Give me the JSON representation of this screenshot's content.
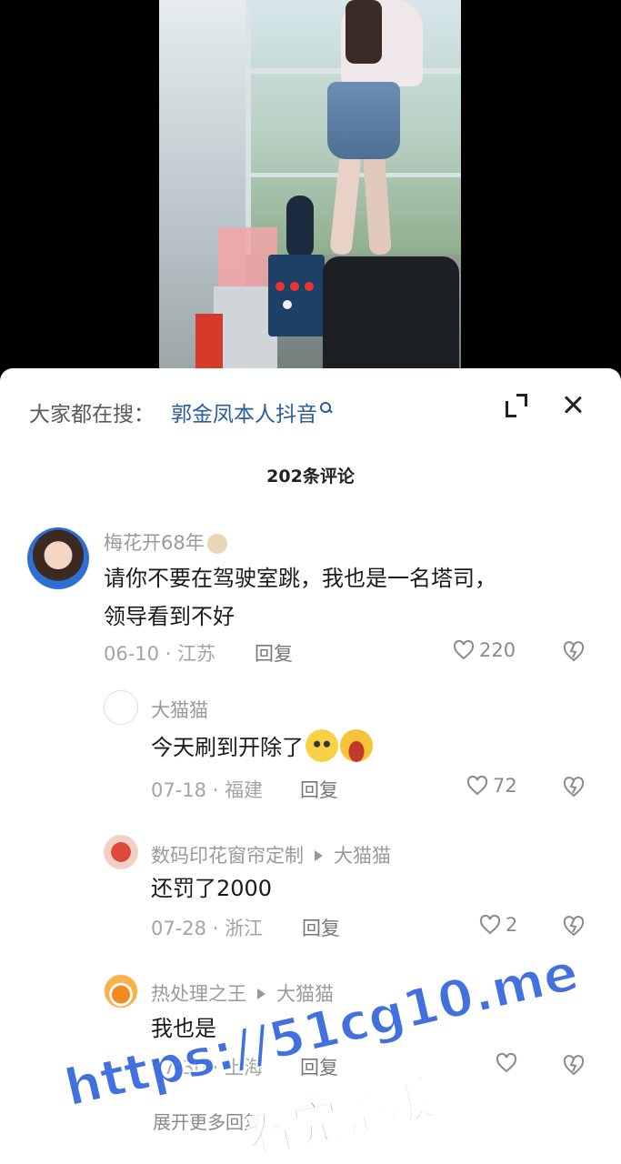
{
  "header": {
    "search_prefix": "大家都在搜：",
    "search_term": "郭金凤本人抖音"
  },
  "comment_count": "202条评论",
  "comments": [
    {
      "user": "梅花开68年",
      "lines": [
        "请你不要在驾驶室跳，我也是一名塔司，",
        "领导看到不好"
      ],
      "date": "06-10",
      "location": "江苏",
      "reply_label": "回复",
      "likes": "220"
    }
  ],
  "replies": [
    {
      "user": "大猫猫",
      "text": "今天刷到开除了",
      "date": "07-18",
      "location": "福建",
      "reply_label": "回复",
      "likes": "72"
    },
    {
      "user": "数码印花窗帘定制",
      "reply_to": "大猫猫",
      "text": "还罚了2000",
      "date": "07-28",
      "location": "浙江",
      "reply_label": "回复",
      "likes": "2"
    },
    {
      "user": "热处理之王",
      "reply_to": "大猫猫",
      "text": "我也是",
      "date": "07-30",
      "location": "上海",
      "reply_label": "回复",
      "likes": ""
    }
  ],
  "expand_more": "展开更多回复",
  "watermark": {
    "line1": "https://51cg10.me",
    "line2": "看完整版"
  },
  "colors": {
    "search_link": "#2c5c9c",
    "watermark": "#3366dd"
  }
}
